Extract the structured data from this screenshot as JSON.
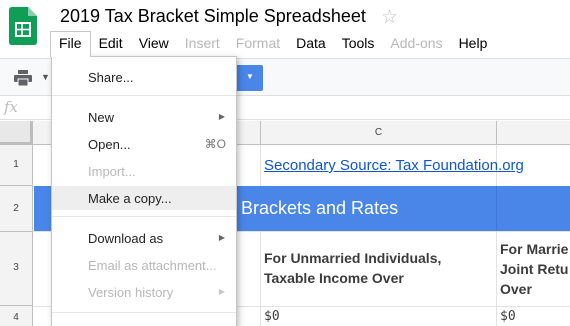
{
  "app": {
    "title": "2019 Tax Bracket Simple Spreadsheet",
    "accent_color": "#0f9d58"
  },
  "menu": [
    {
      "label": "File",
      "state": "open"
    },
    {
      "label": "Edit"
    },
    {
      "label": "View"
    },
    {
      "label": "Insert",
      "disabled": true
    },
    {
      "label": "Format",
      "disabled": true
    },
    {
      "label": "Data"
    },
    {
      "label": "Tools"
    },
    {
      "label": "Add-ons",
      "disabled": true
    },
    {
      "label": "Help"
    }
  ],
  "formula_bar": {
    "icon_label": "fx"
  },
  "file_menu": {
    "items": [
      {
        "label": "Share..."
      },
      {
        "label": "New",
        "submenu": true
      },
      {
        "label": "Open...",
        "shortcut": "⌘O"
      },
      {
        "label": "Import...",
        "disabled": true
      },
      {
        "label": "Make a copy...",
        "highlighted": true
      },
      {
        "label": "Download as",
        "submenu": true
      },
      {
        "label": "Email as attachment...",
        "disabled": true
      },
      {
        "label": "Version history",
        "disabled": true,
        "submenu": true
      }
    ]
  },
  "grid": {
    "columns": [
      "C"
    ],
    "rows": [
      "1",
      "2",
      "3",
      "4"
    ],
    "cells": {
      "c1_link": "Secondary Source: Tax Foundation.org",
      "row2_title": "Brackets and Rates",
      "c3_line1": "For Unmarried Individuals,",
      "c3_line2": "Taxable Income Over",
      "d3_line1": "For Marrie",
      "d3_line2": "Joint Retu",
      "d3_line3": "Over",
      "c4": "$0",
      "d4": "$0"
    },
    "header_fill_color": "#4a86e8",
    "link_color": "#1155cc"
  }
}
